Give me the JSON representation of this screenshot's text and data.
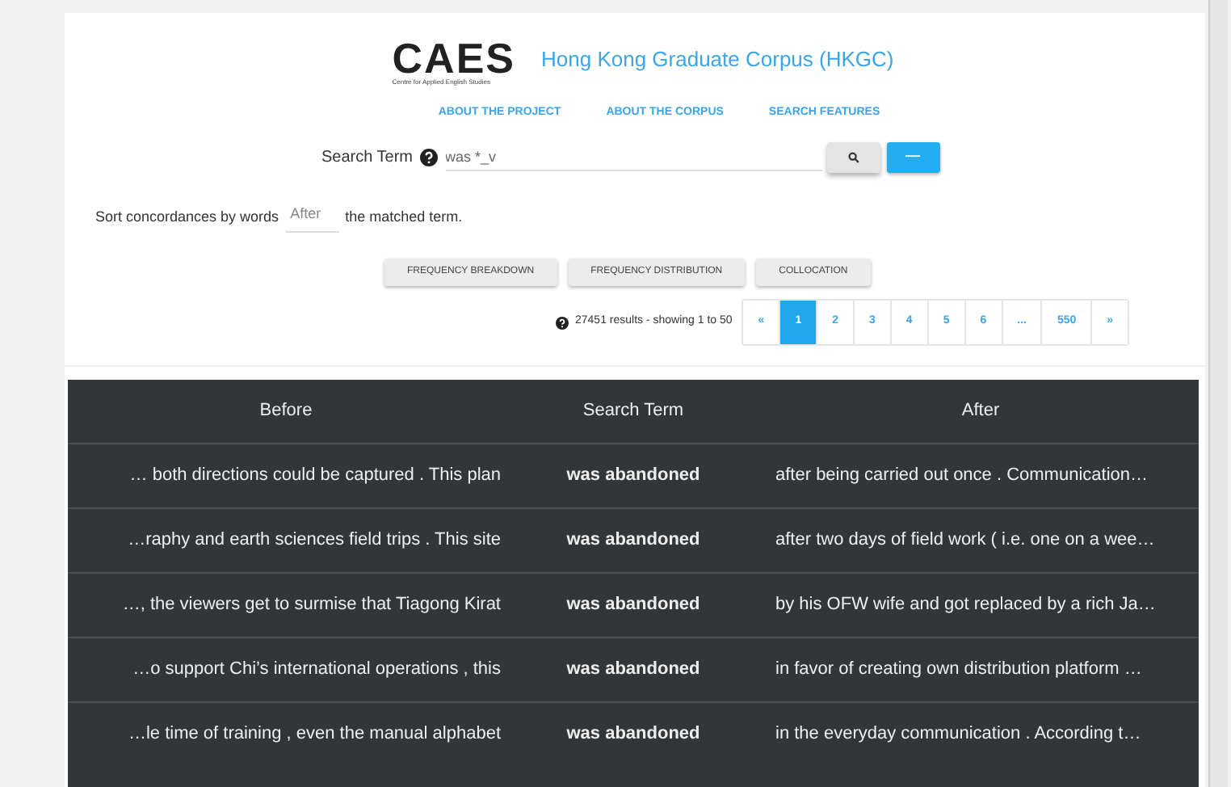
{
  "header": {
    "logo": "CAES",
    "logo_subtitle": "Centre for Applied English Studies",
    "title": "Hong Kong Graduate Corpus (HKGC)"
  },
  "nav": [
    "ABOUT THE PROJECT",
    "ABOUT THE CORPUS",
    "SEARCH FEATURES"
  ],
  "search": {
    "label": "Search Term",
    "value": "was *_v",
    "extra_button": "—"
  },
  "sort": {
    "prefix": "Sort concordances by words",
    "value": "After",
    "suffix": "the matched term."
  },
  "tools": [
    "FREQUENCY BREAKDOWN",
    "FREQUENCY DISTRIBUTION",
    "COLLOCATION"
  ],
  "results_summary": "27451 results - showing 1 to 50",
  "pagination": [
    {
      "label": "«",
      "selected": false
    },
    {
      "label": "1",
      "selected": true
    },
    {
      "label": "2",
      "selected": false
    },
    {
      "label": "3",
      "selected": false
    },
    {
      "label": "4",
      "selected": false
    },
    {
      "label": "5",
      "selected": false
    },
    {
      "label": "6",
      "selected": false
    },
    {
      "label": "...",
      "selected": false
    },
    {
      "label": "550",
      "selected": false
    },
    {
      "label": "»",
      "selected": false
    }
  ],
  "table": {
    "columns": [
      "Before",
      "Search Term",
      "After"
    ],
    "rows": [
      [
        "… both directions could be captured . This plan",
        "was abandoned",
        "after being carried out once . Communication…"
      ],
      [
        "…raphy and earth sciences field trips . This site",
        "was abandoned",
        "after two days of field work ( i.e. one on a wee…"
      ],
      [
        "…, the viewers get to surmise that Tiagong Kirat",
        "was abandoned",
        "by his OFW wife and got replaced by a rich Ja…"
      ],
      [
        "…o support Chi’s international operations , this",
        "was abandoned",
        "in favor of creating own distribution platform …"
      ],
      [
        "…le time of training , even the manual alphabet",
        "was abandoned",
        "in the everyday communication . According t…"
      ]
    ]
  }
}
